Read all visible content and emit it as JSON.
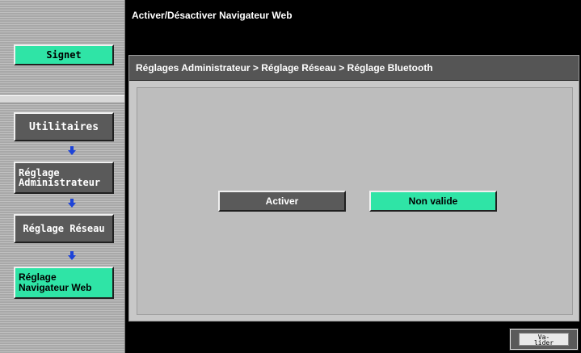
{
  "header": {
    "title": "Activer/Désactiver Navigateur Web"
  },
  "sidebar": {
    "bookmark": "Signet",
    "utilities": "Utilitaires",
    "admin_line1": "Réglage",
    "admin_line2": "Administrateur",
    "network": "Réglage Réseau",
    "browser_line1": "Réglage",
    "browser_line2": "Navigateur Web",
    "arrow_icon": "down-arrow-icon"
  },
  "main": {
    "breadcrumb": "Réglages Administrateur > Réglage Réseau > Réglage Bluetooth",
    "options": [
      {
        "label": "Activer",
        "selected": false
      },
      {
        "label": "Non valide",
        "selected": true
      }
    ]
  },
  "footer": {
    "validate_line1": "Va-",
    "validate_line2": "lider"
  },
  "colors": {
    "selected_green": "#2fe4a6",
    "unselected_grey": "#5a5a5a",
    "arrow_blue": "#1d43d8"
  }
}
